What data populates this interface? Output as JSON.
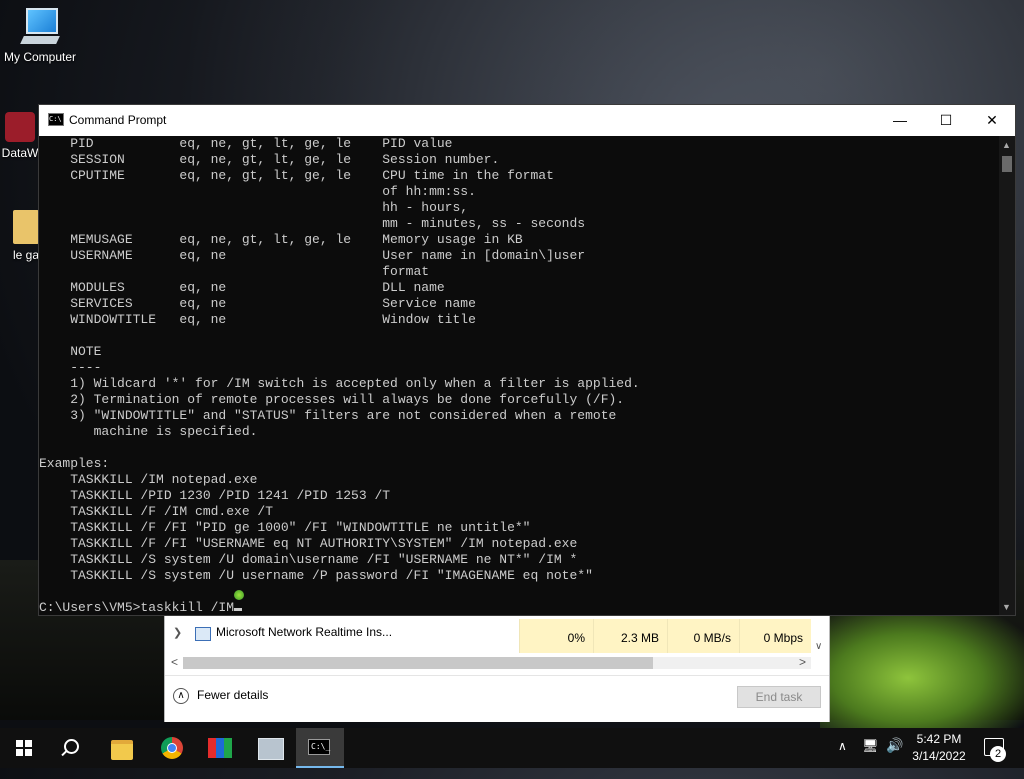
{
  "desktop": {
    "icons": [
      {
        "label": "My Computer",
        "icon": "computer-icon"
      },
      {
        "label": "DataW",
        "icon": "app-icon"
      },
      {
        "label": "le ga",
        "icon": "file-icon"
      }
    ]
  },
  "task_manager": {
    "row": {
      "name": "Microsoft Network Realtime Ins...",
      "cpu": "0%",
      "memory": "2.3 MB",
      "disk": "0 MB/s",
      "network": "0 Mbps"
    },
    "fewer_details_label": "Fewer details",
    "end_task_label": "End task"
  },
  "cmd": {
    "title": "Command Prompt",
    "lines": [
      "    PID           eq, ne, gt, lt, ge, le    PID value",
      "    SESSION       eq, ne, gt, lt, ge, le    Session number.",
      "    CPUTIME       eq, ne, gt, lt, ge, le    CPU time in the format",
      "                                            of hh:mm:ss.",
      "                                            hh - hours,",
      "                                            mm - minutes, ss - seconds",
      "    MEMUSAGE      eq, ne, gt, lt, ge, le    Memory usage in KB",
      "    USERNAME      eq, ne                    User name in [domain\\]user",
      "                                            format",
      "    MODULES       eq, ne                    DLL name",
      "    SERVICES      eq, ne                    Service name",
      "    WINDOWTITLE   eq, ne                    Window title",
      "",
      "    NOTE",
      "    ----",
      "    1) Wildcard '*' for /IM switch is accepted only when a filter is applied.",
      "    2) Termination of remote processes will always be done forcefully (/F).",
      "    3) \"WINDOWTITLE\" and \"STATUS\" filters are not considered when a remote",
      "       machine is specified.",
      "",
      "Examples:",
      "    TASKKILL /IM notepad.exe",
      "    TASKKILL /PID 1230 /PID 1241 /PID 1253 /T",
      "    TASKKILL /F /IM cmd.exe /T",
      "    TASKKILL /F /FI \"PID ge 1000\" /FI \"WINDOWTITLE ne untitle*\"",
      "    TASKKILL /F /FI \"USERNAME eq NT AUTHORITY\\SYSTEM\" /IM notepad.exe",
      "    TASKKILL /S system /U domain\\username /FI \"USERNAME ne NT*\" /IM *",
      "    TASKKILL /S system /U username /P password /FI \"IMAGENAME eq note*\"",
      ""
    ],
    "prompt": "C:\\Users\\VM5>taskkill /IM"
  },
  "taskbar": {
    "apps": [
      "start-icon",
      "search-icon",
      "file-explorer-icon",
      "chrome-icon",
      "app-icon",
      "app-icon",
      "command-prompt-icon"
    ],
    "time": "5:42 PM",
    "date": "3/14/2022",
    "notification_count": "2"
  }
}
